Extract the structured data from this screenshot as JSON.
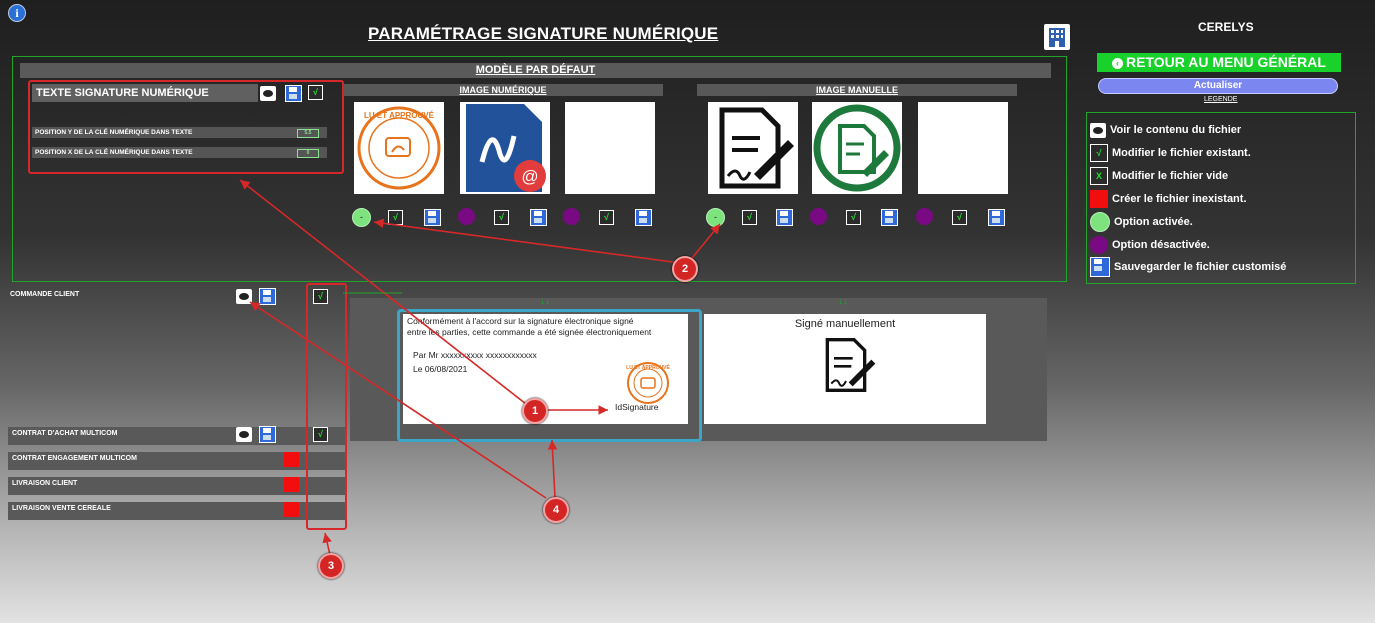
{
  "header": {
    "title": "PARAMÉTRAGE SIGNATURE NUMÉRIQUE",
    "company": "CERELYS",
    "back_button": "RETOUR AU MENU GÉNÉRAL",
    "refresh_button": "Actualiser",
    "legend_link": "LEGENDE"
  },
  "model": {
    "title": "MODÈLE PAR DÉFAUT",
    "text_section": {
      "title": "TEXTE SIGNATURE NUMÉRIQUE",
      "rows": [
        {
          "label": "POSITION Y DE LA CLÉ NUMÉRIQUE DANS TEXTE",
          "value": "5.5"
        },
        {
          "label": "POSITION X DE LA CLÉ NUMÉRIQUE DANS TEXTE",
          "value": "0"
        }
      ]
    },
    "image_numerique": {
      "title": "IMAGE NUMÉRIQUE",
      "option_active_label": "-"
    },
    "image_manuelle": {
      "title": "IMAGE MANUELLE",
      "option_active_label": "-"
    }
  },
  "documents": [
    {
      "label": "COMMANDE CLIENT",
      "state": "existing"
    },
    {
      "label": "CONTRAT D'ACHAT MULTICOM",
      "state": "existing"
    },
    {
      "label": "CONTRAT ENGAGEMENT MULTICOM",
      "state": "missing"
    },
    {
      "label": "LIVRAISON CLIENT",
      "state": "missing"
    },
    {
      "label": "LIVRAISON VENTE CEREALE",
      "state": "missing"
    }
  ],
  "preview": {
    "text_line1": "Conformément à l'accord sur la signature électronique signé",
    "text_line2": "entre les parties, cette commande a été signée électroniquement",
    "signer": "Par Mr xxxxxxxxxx xxxxxxxxxxxx",
    "date": "Le 06/08/2021",
    "sig_id": "IdSignature",
    "manual_title": "Signé manuellement",
    "arrow_glyph": "↓↓",
    "stamp_text": "LU ET APPROUVÉ"
  },
  "legend": [
    {
      "icon": "eye-icon",
      "label": "Voir le contenu du fichier"
    },
    {
      "icon": "check-icon",
      "label": "Modifier le fichier existant."
    },
    {
      "icon": "x-icon",
      "label": "Modifier le fichier vide"
    },
    {
      "icon": "red-square-icon",
      "label": "Créer le fichier inexistant."
    },
    {
      "icon": "green-circle-icon",
      "label": "Option activée."
    },
    {
      "icon": "purple-circle-icon",
      "label": "Option désactivée."
    },
    {
      "icon": "save-icon",
      "label": "Sauvegarder le fichier customisé"
    }
  ],
  "annotations": [
    "1",
    "2",
    "3",
    "4"
  ],
  "glyphs": {
    "check": "√",
    "x": "X",
    "info": "i",
    "back": "‹"
  },
  "colors": {
    "accent_green": "#18d12a",
    "annotation_red": "#d62828",
    "preview_border": "#3ba6c8",
    "option_off": "#7a0a83"
  }
}
